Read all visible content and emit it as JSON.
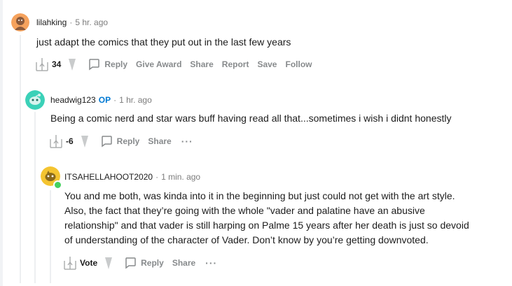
{
  "comments": [
    {
      "author": "lilahking",
      "op_badge": "",
      "time": "5 hr. ago",
      "text": "just adapt the comics that they put out in the last few years",
      "score": "34",
      "actions": [
        "Reply",
        "Give Award",
        "Share",
        "Report",
        "Save",
        "Follow"
      ],
      "more": ""
    },
    {
      "author": "headwig123",
      "op_badge": "OP",
      "time": "1 hr. ago",
      "text": "Being a comic nerd and star wars buff having read all that...sometimes i wish i didnt honestly",
      "score": "-6",
      "actions": [
        "Reply",
        "Share"
      ],
      "more": "···"
    },
    {
      "author": "ITSAHELLAHOOT2020",
      "op_badge": "",
      "time": "1 min. ago",
      "text_lines": [
        "You and me both, was kinda into it in the beginning but just could not get with the art style.",
        "Also, the fact that they’re going with the whole \"vader and palatine have an abusive",
        "relationship\" and that vader is still harping on Palme 15 years after her death is just so devoid",
        "of understanding of the character of Vader. Don’t know by you’re getting downvoted."
      ],
      "score": "Vote",
      "actions": [
        "Reply",
        "Share"
      ],
      "more": "···"
    }
  ],
  "separator": "·",
  "colors": {
    "avatar1": "#f5a25d",
    "avatar2": "#3bd1b8",
    "avatar3": "#f4c430",
    "op": "#0079d3",
    "online": "#46d160",
    "muted": "#878a8c"
  },
  "icons": {
    "upvote": "xwing-upvote-icon",
    "downvote": "downvote-icon",
    "reply": "speech-bubble-icon"
  }
}
